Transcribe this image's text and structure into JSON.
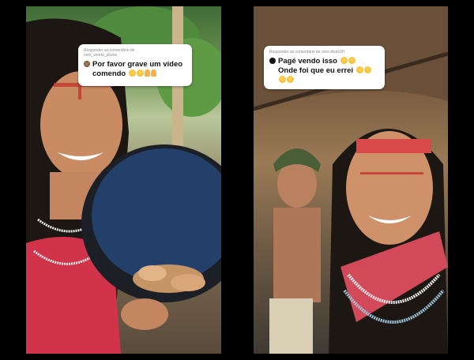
{
  "left_panel": {
    "comment": {
      "reply_label_line1": "Responder ao comentário de",
      "reply_label_line2": "vem_vendo_povos",
      "text_line1": "Por favor grave um vídeo",
      "text_line2": "comendo",
      "emojis": [
        "laughing-emoji",
        "laughing-emoji",
        "praying-hands-emoji",
        "praying-hands-emoji"
      ]
    }
  },
  "right_panel": {
    "comment": {
      "reply_label": "Responder ao comentário de vitor.silva100",
      "text_line1": "Pagé vendo isso",
      "text_line2": "Onde foi que eu errei",
      "emojis": [
        "laughing-emoji",
        "laughing-emoji",
        "laughing-emoji",
        "laughing-emoji",
        "laughing-emoji",
        "laughing-emoji"
      ]
    }
  },
  "colors": {
    "background": "#000000",
    "comment_card": "#ffffff",
    "face_paint_red": "#d0342c",
    "headband_red": "#d84a4a"
  }
}
